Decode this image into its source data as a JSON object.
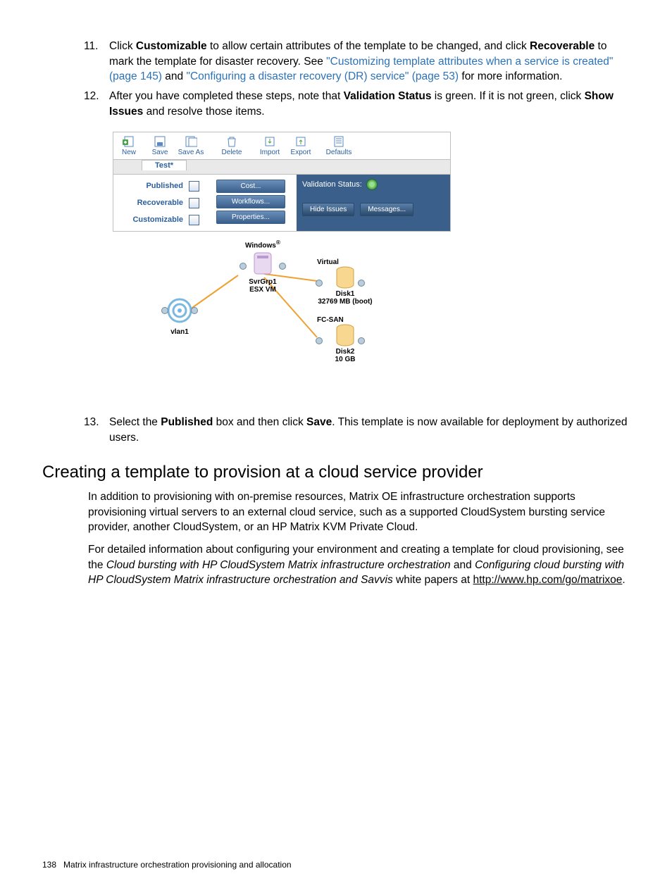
{
  "steps": {
    "s11": {
      "num": "11.",
      "pre": "Click ",
      "b1": "Customizable",
      "mid1": " to allow certain attributes of the template to be changed, and click ",
      "b2": "Recoverable",
      "mid2": " to mark the template for disaster recovery. See ",
      "link1": "\"Customizing template attributes when a service is created\" (page 145)",
      "mid3": " and ",
      "link2": "\"Configuring a disaster recovery (DR) service\" (page 53)",
      "tail": " for more information."
    },
    "s12": {
      "num": "12.",
      "pre": "After you have completed these steps, note that ",
      "b1": "Validation Status",
      "mid1": " is green. If it is not green, click ",
      "b2": "Show Issues",
      "tail": " and resolve those items."
    },
    "s13": {
      "num": "13.",
      "pre": "Select the ",
      "b1": "Published",
      "mid1": " box and then click ",
      "b2": "Save",
      "tail": ". This template is now available for deployment by authorized users."
    }
  },
  "app": {
    "toolbar": {
      "new": "New",
      "save": "Save",
      "saveas": "Save As",
      "delete": "Delete",
      "import": "Import",
      "export": "Export",
      "defaults": "Defaults"
    },
    "tab": "Test*",
    "checks": {
      "published": "Published",
      "recoverable": "Recoverable",
      "customizable": "Customizable"
    },
    "buttons": {
      "cost": "Cost...",
      "workflows": "Workflows...",
      "properties": "Properties..."
    },
    "validation": {
      "label": "Validation Status:",
      "hide": "Hide Issues",
      "messages": "Messages..."
    },
    "diagram": {
      "windows": "Windows",
      "svr1": "SvrGrp1",
      "svr2": "ESX VM",
      "vlan": "vlan1",
      "virtual": "Virtual",
      "disk1a": "Disk1",
      "disk1b": "32769 MB (boot)",
      "fcsan": "FC-SAN",
      "disk2a": "Disk2",
      "disk2b": "10 GB"
    }
  },
  "section": {
    "heading": "Creating a template to provision at a cloud service provider",
    "p1": "In addition to provisioning with on-premise resources, Matrix OE infrastructure orchestration supports provisioning virtual servers to an external cloud service, such as a supported CloudSystem bursting service provider, another CloudSystem, or an HP Matrix KVM Private Cloud.",
    "p2_pre": "For detailed information about configuring your environment and creating a template for cloud provisioning, see the ",
    "p2_i1": "Cloud bursting with HP CloudSystem Matrix infrastructure orchestration",
    "p2_mid": " and ",
    "p2_i2": "Configuring cloud bursting with HP CloudSystem Matrix infrastructure orchestration and Savvis",
    "p2_post1": " white papers at ",
    "p2_url": "http://www.hp.com/go/matrixoe",
    "p2_post2": "."
  },
  "footer": {
    "pagenum": "138",
    "title": "Matrix infrastructure orchestration provisioning and allocation"
  }
}
